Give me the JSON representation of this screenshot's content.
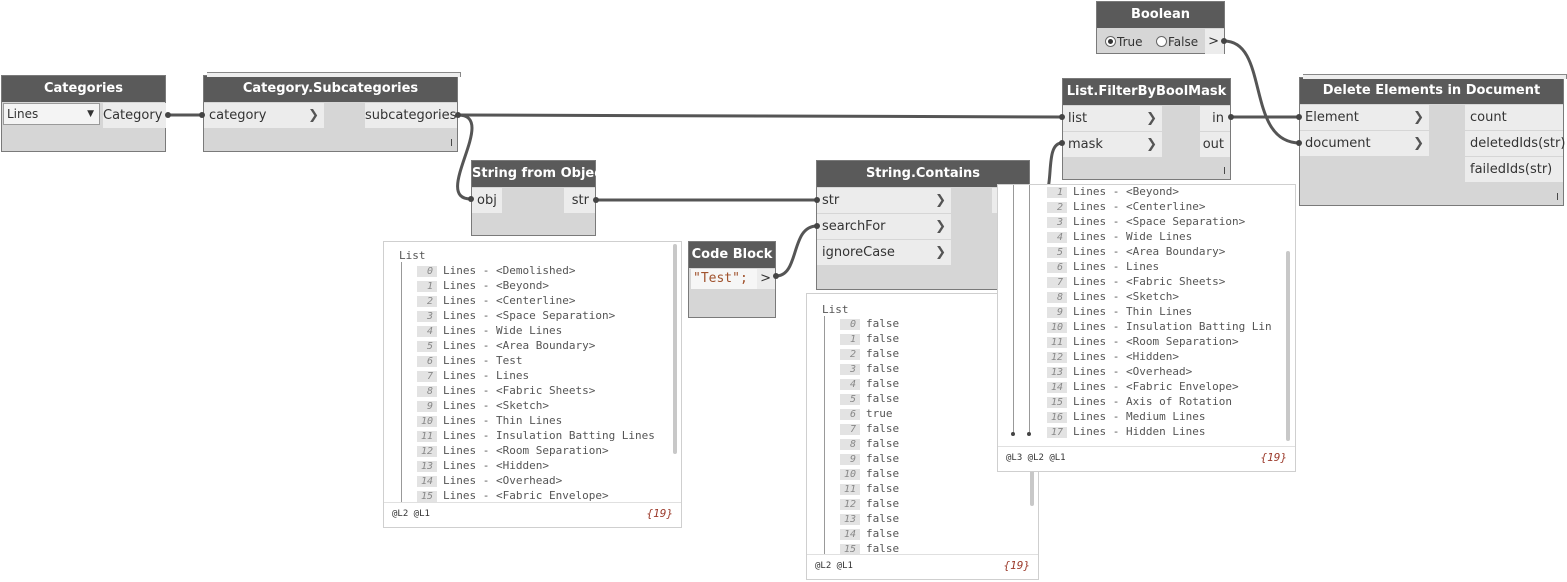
{
  "nodes": {
    "categories": {
      "title": "Categories",
      "dropdown_value": "Lines",
      "output": "Category"
    },
    "category_subcategories": {
      "title": "Category.Subcategories",
      "input": "category",
      "output": "subcategories",
      "lacing": "I"
    },
    "string_from_object": {
      "title": "String from Object",
      "input": "obj",
      "output": "str"
    },
    "code_block": {
      "title": "Code Block",
      "code": "\"Test\";",
      "output": ">"
    },
    "string_contains": {
      "title": "String.Contains",
      "inputs": [
        "str",
        "searchFor",
        "ignoreCase"
      ]
    },
    "boolean": {
      "title": "Boolean",
      "true_label": "True",
      "false_label": "False",
      "selected": "True",
      "output": ">"
    },
    "filter_by_bool_mask": {
      "title": "List.FilterByBoolMask",
      "inputs": [
        "list",
        "mask"
      ],
      "outputs": [
        "in",
        "out"
      ],
      "lacing": "I"
    },
    "delete_elements": {
      "title": "Delete Elements in Document",
      "inputs": [
        "Element",
        "document"
      ],
      "outputs": [
        "count",
        "deletedIds(str)",
        "failedIds(str)"
      ],
      "lacing": "I"
    }
  },
  "previews": {
    "string_from_object": {
      "header": "List",
      "items": [
        {
          "i": "0",
          "v": "Lines - <Demolished>"
        },
        {
          "i": "1",
          "v": "Lines - <Beyond>"
        },
        {
          "i": "2",
          "v": "Lines - <Centerline>"
        },
        {
          "i": "3",
          "v": "Lines - <Space Separation>"
        },
        {
          "i": "4",
          "v": "Lines - Wide Lines"
        },
        {
          "i": "5",
          "v": "Lines - <Area Boundary>"
        },
        {
          "i": "6",
          "v": "Lines - Test"
        },
        {
          "i": "7",
          "v": "Lines - Lines"
        },
        {
          "i": "8",
          "v": "Lines - <Fabric Sheets>"
        },
        {
          "i": "9",
          "v": "Lines - <Sketch>"
        },
        {
          "i": "10",
          "v": "Lines - Thin Lines"
        },
        {
          "i": "11",
          "v": "Lines - Insulation Batting Lines"
        },
        {
          "i": "12",
          "v": "Lines - <Room Separation>"
        },
        {
          "i": "13",
          "v": "Lines - <Hidden>"
        },
        {
          "i": "14",
          "v": "Lines - <Overhead>"
        },
        {
          "i": "15",
          "v": "Lines - <Fabric Envelope>"
        }
      ],
      "levels": "@L2 @L1",
      "count": "{19}"
    },
    "string_contains": {
      "header": "List",
      "items": [
        {
          "i": "0",
          "v": "false"
        },
        {
          "i": "1",
          "v": "false"
        },
        {
          "i": "2",
          "v": "false"
        },
        {
          "i": "3",
          "v": "false"
        },
        {
          "i": "4",
          "v": "false"
        },
        {
          "i": "5",
          "v": "false"
        },
        {
          "i": "6",
          "v": "true"
        },
        {
          "i": "7",
          "v": "false"
        },
        {
          "i": "8",
          "v": "false"
        },
        {
          "i": "9",
          "v": "false"
        },
        {
          "i": "10",
          "v": "false"
        },
        {
          "i": "11",
          "v": "false"
        },
        {
          "i": "12",
          "v": "false"
        },
        {
          "i": "13",
          "v": "false"
        },
        {
          "i": "14",
          "v": "false"
        },
        {
          "i": "15",
          "v": "false"
        }
      ],
      "levels": "@L2 @L1",
      "count": "{19}"
    },
    "filter_by_bool_mask": {
      "items": [
        {
          "i": "1",
          "v": "Lines - <Beyond>"
        },
        {
          "i": "2",
          "v": "Lines - <Centerline>"
        },
        {
          "i": "3",
          "v": "Lines - <Space Separation>"
        },
        {
          "i": "4",
          "v": "Lines - Wide Lines"
        },
        {
          "i": "5",
          "v": "Lines - <Area Boundary>"
        },
        {
          "i": "6",
          "v": "Lines - Lines"
        },
        {
          "i": "7",
          "v": "Lines - <Fabric Sheets>"
        },
        {
          "i": "8",
          "v": "Lines - <Sketch>"
        },
        {
          "i": "9",
          "v": "Lines - Thin Lines"
        },
        {
          "i": "10",
          "v": "Lines - Insulation Batting Lin"
        },
        {
          "i": "11",
          "v": "Lines - <Room Separation>"
        },
        {
          "i": "12",
          "v": "Lines - <Hidden>"
        },
        {
          "i": "13",
          "v": "Lines - <Overhead>"
        },
        {
          "i": "14",
          "v": "Lines - <Fabric Envelope>"
        },
        {
          "i": "15",
          "v": "Lines - Axis of Rotation"
        },
        {
          "i": "16",
          "v": "Lines - Medium Lines"
        },
        {
          "i": "17",
          "v": "Lines - Hidden Lines"
        }
      ],
      "levels": "@L3 @L2 @L1",
      "count": "{19}"
    }
  },
  "colors": {
    "wire": "#555555",
    "node_body": "#d6d6d6",
    "title_bar": "#5a5a5a",
    "item_count": "#9c3b2c"
  }
}
